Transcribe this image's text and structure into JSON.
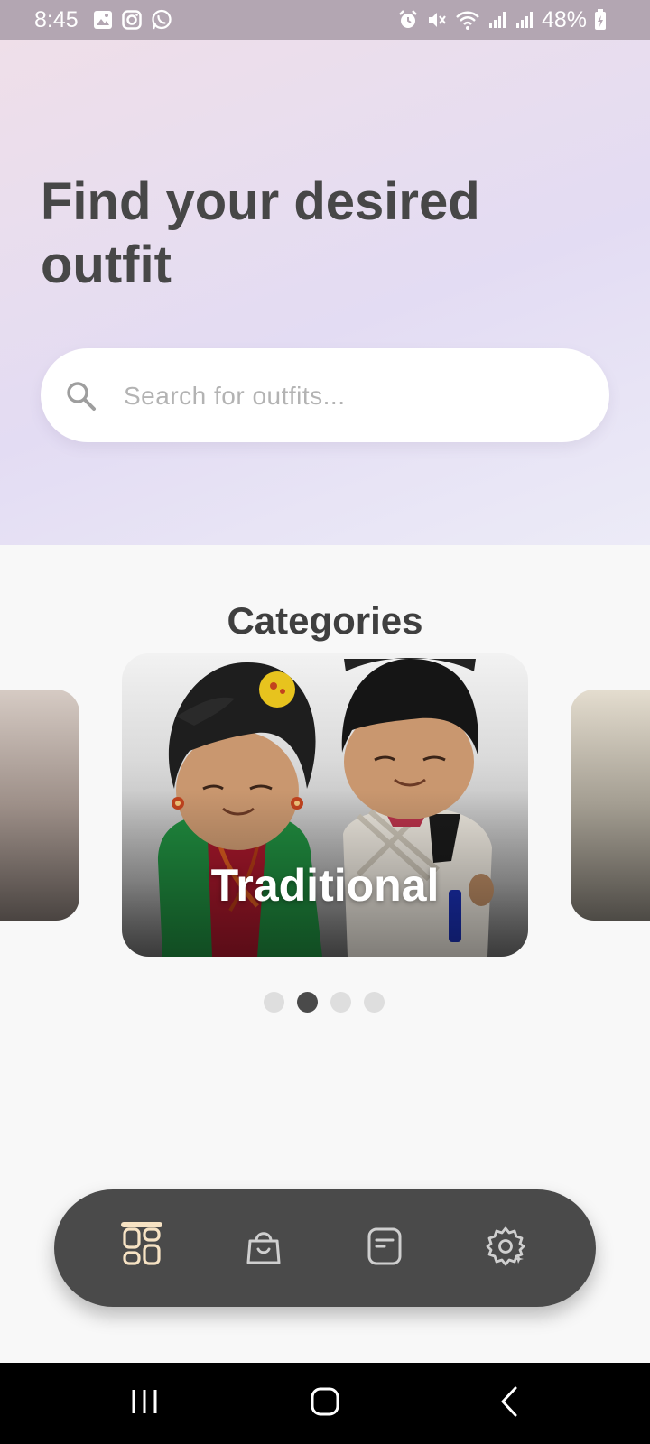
{
  "status_bar": {
    "time": "8:45",
    "battery": "48%",
    "left_icons": [
      "gallery-icon",
      "instagram-icon",
      "whatsapp-icon"
    ],
    "right_icons": [
      "alarm-icon",
      "mute-icon",
      "wifi-icon",
      "signal-icon",
      "signal-icon",
      "battery-icon"
    ]
  },
  "header": {
    "title": "Find your desired outfit",
    "search": {
      "placeholder": "Search for outfits...",
      "value": ""
    }
  },
  "categories": {
    "title": "Categories",
    "current_label": "Traditional",
    "page_count": 4,
    "active_page": 2
  },
  "bottom_nav": {
    "items": [
      "dashboard-icon",
      "shopping-bag-icon",
      "orders-icon",
      "settings-icon"
    ],
    "active_index": 0,
    "accent_color": "#f7e3c4"
  },
  "system_nav": {
    "items": [
      "recent-apps-icon",
      "home-icon",
      "back-icon"
    ]
  },
  "colors": {
    "nav_background": "#4a4a4a",
    "title_color": "#474747"
  }
}
